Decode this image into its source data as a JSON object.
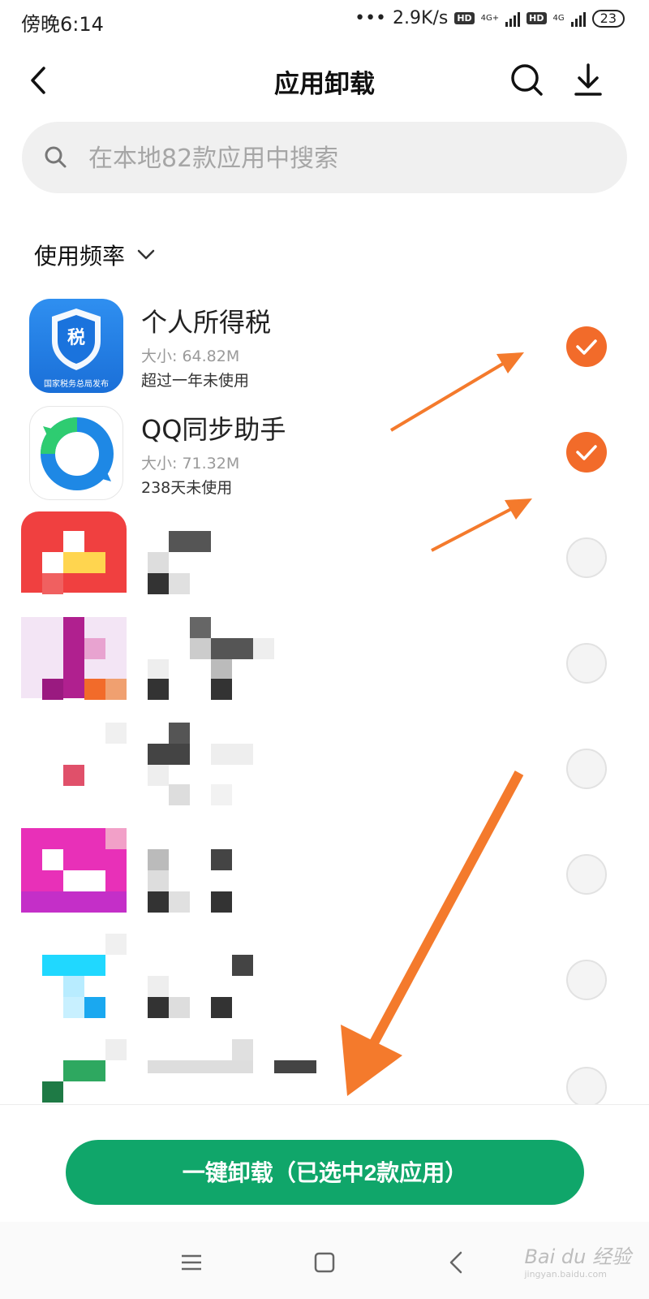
{
  "status_bar": {
    "time": "傍晚6:14",
    "speed": "2.9K/s",
    "hd1": "HD",
    "net1": "4G+",
    "hd2": "HD",
    "net2": "4G",
    "battery": "23"
  },
  "header": {
    "title": "应用卸载",
    "icons": [
      "back-icon",
      "search-icon",
      "download-icon"
    ]
  },
  "search": {
    "placeholder": "在本地82款应用中搜索"
  },
  "sort": {
    "label": "使用频率"
  },
  "apps": [
    {
      "name": "个人所得税",
      "size": "大小: 64.82M",
      "last_used": "超过一年未使用",
      "selected": true,
      "icon_caption": "国家税务总局发布",
      "icon_badge": "税"
    },
    {
      "name": "QQ同步助手",
      "size": "大小: 71.32M",
      "last_used": "238天未使用",
      "selected": true
    },
    {
      "name": "",
      "size": "",
      "last_used": "",
      "selected": false
    },
    {
      "name": "",
      "size": "",
      "last_used": "",
      "selected": false
    },
    {
      "name": "",
      "size": "",
      "last_used": "",
      "selected": false
    },
    {
      "name": "",
      "size": "",
      "last_used": "",
      "selected": false
    },
    {
      "name": "",
      "size": "",
      "last_used": "",
      "selected": false
    },
    {
      "name": "",
      "size": "",
      "last_used": "",
      "selected": false
    }
  ],
  "uninstall_button": "一键卸载（已选中2款应用）",
  "watermark": {
    "text": "Bai du 经验",
    "sub": "jingyan.baidu.com"
  },
  "colors": {
    "accent": "#f26b2a",
    "primary": "#10a66a"
  }
}
